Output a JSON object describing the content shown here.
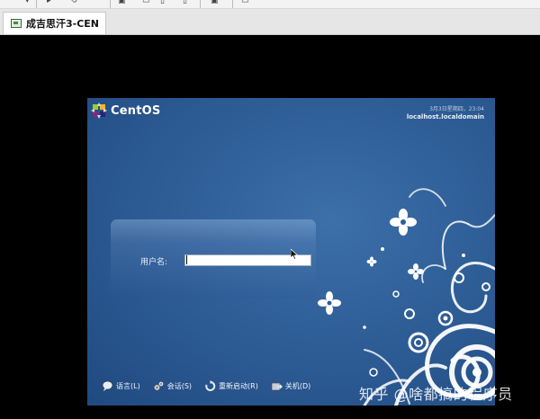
{
  "tab": {
    "title": "成吉思汗3-CEN",
    "icon": "vm-icon"
  },
  "toolbar": {
    "icons": [
      "back-icon",
      "forward-icon",
      "refresh-icon",
      "snapshot-icon",
      "fullscreen-icon",
      "console-icon"
    ]
  },
  "vm": {
    "os_name": "CentOS",
    "clock_date": "3月3日星期四，23:04",
    "hostname": "localhost.localdomain",
    "username_label": "用户名:",
    "username_value": "",
    "bottom_bar": {
      "language_label": "语言(L)",
      "session_label": "会话(S)",
      "restart_label": "重新启动(R)",
      "shutdown_label": "关机(D)"
    }
  },
  "watermark": "知乎 @啥都搞的程序员"
}
